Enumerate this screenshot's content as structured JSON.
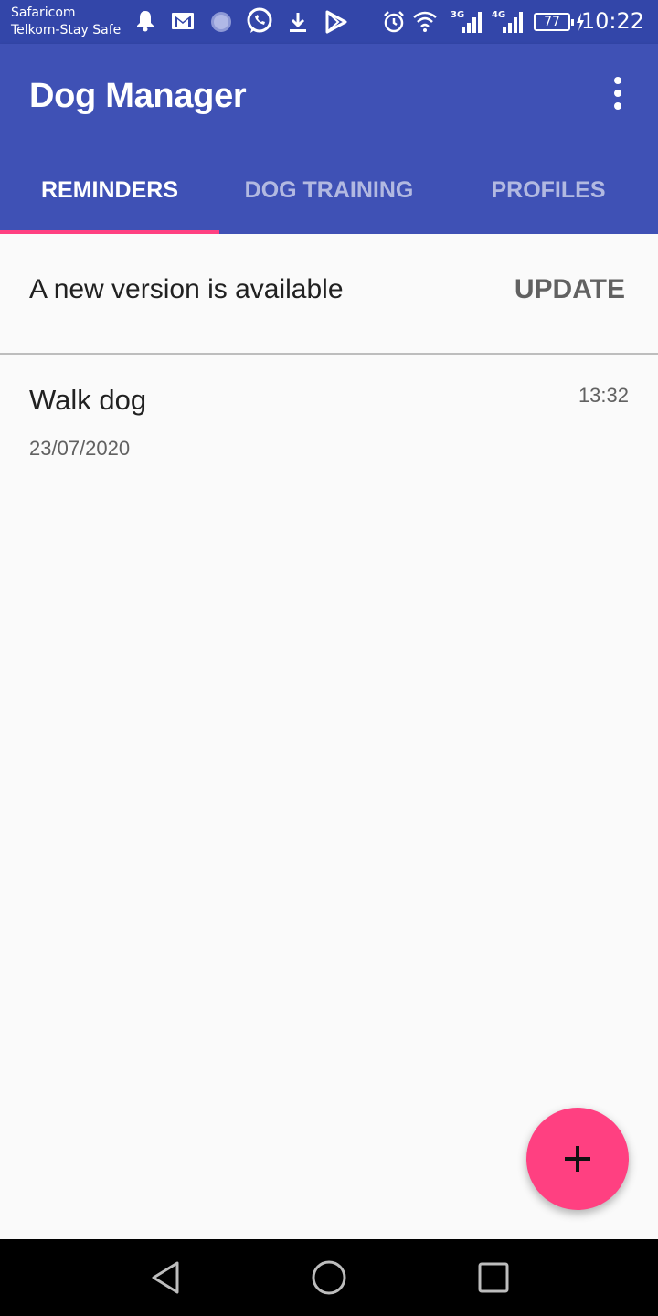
{
  "status_bar": {
    "carrier_1": "Safaricom",
    "carrier_2": "Telkom-Stay Safe",
    "net_3g": "3G",
    "net_4g": "4G",
    "battery": "77",
    "time": "10:22"
  },
  "app_bar": {
    "title": "Dog Manager",
    "background_color": "#3f51b5",
    "accent_color": "#ff4081"
  },
  "tabs": [
    {
      "label": "REMINDERS",
      "active": true
    },
    {
      "label": "DOG TRAINING",
      "active": false
    },
    {
      "label": "PROFILES",
      "active": false
    }
  ],
  "update_banner": {
    "text": "A new version is available",
    "button_label": "UPDATE"
  },
  "reminders": [
    {
      "title": "Walk dog",
      "date": "23/07/2020",
      "time": "13:32"
    }
  ],
  "icons": {
    "notification": "bell-icon",
    "mail": "gmail-icon",
    "whatsapp": "whatsapp-icon",
    "download": "download-icon",
    "play_store": "play-store-icon",
    "alarm": "alarm-icon",
    "wifi": "wifi-icon",
    "fab": "plus-icon",
    "nav_back": "back-triangle-icon",
    "nav_home": "home-circle-icon",
    "nav_recents": "recents-square-icon"
  }
}
